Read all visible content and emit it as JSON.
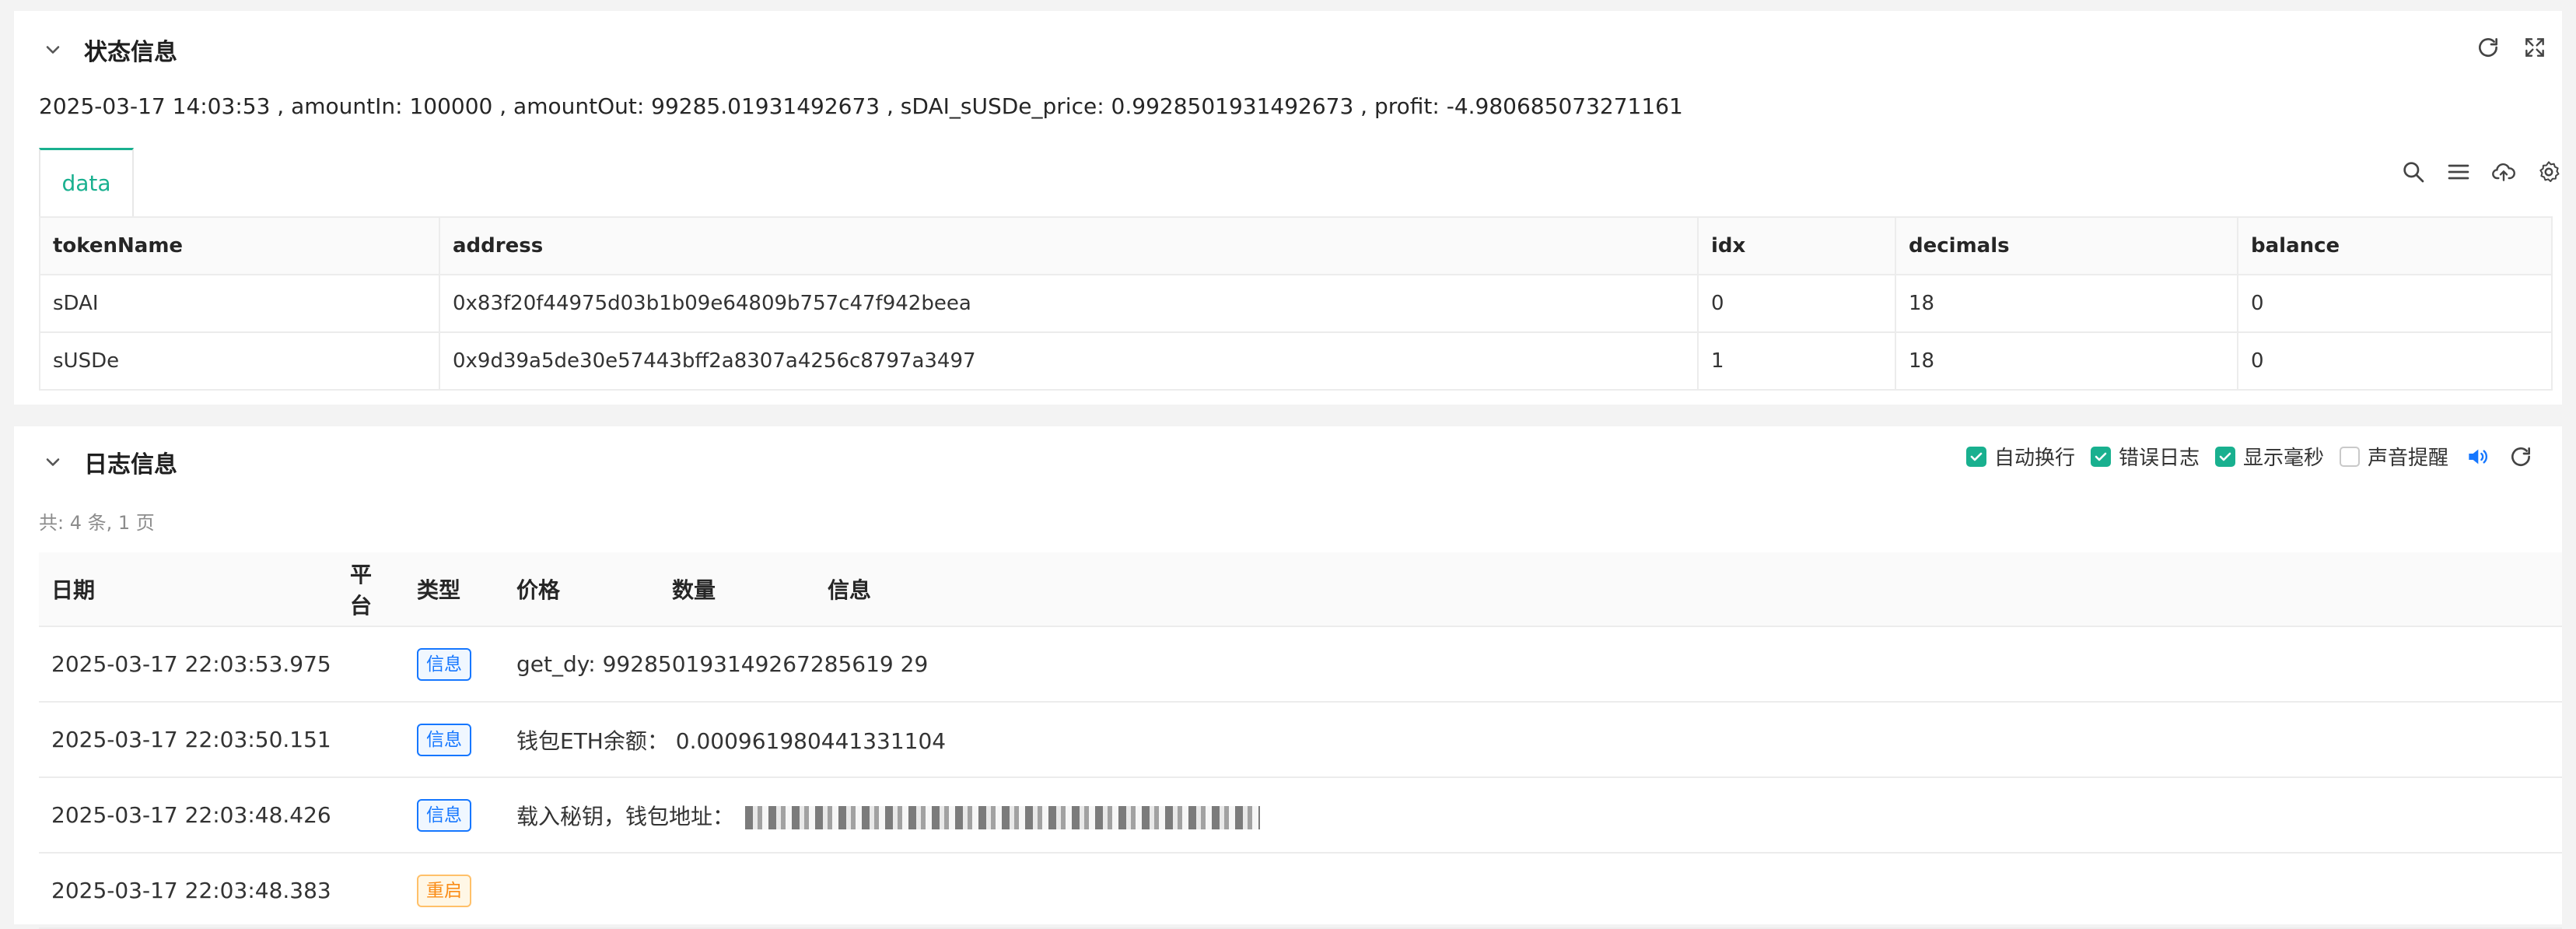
{
  "colors": {
    "accent": "#19b08f",
    "info": "#1677ff",
    "restart": "#fa8c16",
    "speaker": "#1677ff"
  },
  "status_panel": {
    "title": "状态信息",
    "header_icons": [
      "refresh-icon",
      "fullscreen-icon"
    ],
    "status_line": "2025-03-17 14:03:53 , amountIn: 100000 , amountOut: 99285.01931492673 , sDAI_sUSDe_price: 0.9928501931492673 , profit: -4.980685073271161",
    "tab_label": "data",
    "tab_tools": [
      "search-icon",
      "list-icon",
      "cloud-upload-icon",
      "gear-icon"
    ],
    "table": {
      "headers": [
        "tokenName",
        "address",
        "idx",
        "decimals",
        "balance"
      ],
      "rows": [
        [
          "sDAI",
          "0x83f20f44975d03b1b09e64809b757c47f942beea",
          "0",
          "18",
          "0"
        ],
        [
          "sUSDe",
          "0x9d39a5de30e57443bff2a8307a4256c8797a3497",
          "1",
          "18",
          "0"
        ]
      ]
    }
  },
  "log_panel": {
    "title": "日志信息",
    "options": [
      {
        "label": "自动换行",
        "checked": true
      },
      {
        "label": "错误日志",
        "checked": true
      },
      {
        "label": "显示毫秒",
        "checked": true
      },
      {
        "label": "声音提醒",
        "checked": false
      }
    ],
    "count_text": "共: 4 条, 1 页",
    "headers": [
      "日期",
      "平台",
      "类型",
      "价格",
      "数量",
      "信息"
    ],
    "rows": [
      {
        "date": "2025-03-17 22:03:53.975",
        "type": "信息",
        "message": "get_dy: 992850193149267285619 29"
      },
      {
        "date": "2025-03-17 22:03:50.151",
        "type": "信息",
        "message": "钱包ETH余额： 0.000961980441331104"
      },
      {
        "date": "2025-03-17 22:03:48.426",
        "type": "信息",
        "message": "载入秘钥，钱包地址："
      },
      {
        "date": "2025-03-17 22:03:48.383",
        "type": "重启",
        "message": ""
      }
    ]
  }
}
